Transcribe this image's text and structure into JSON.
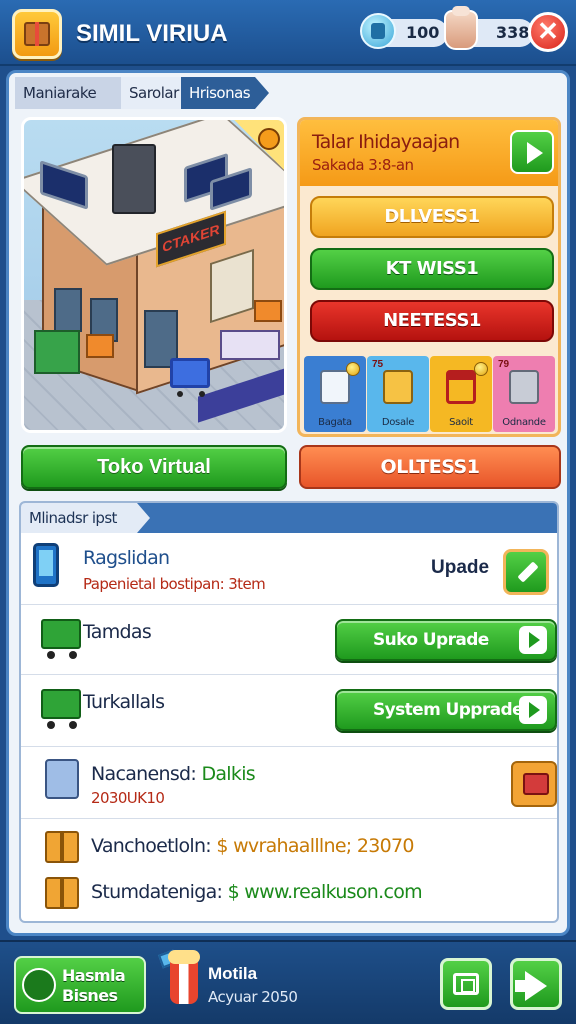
{
  "header": {
    "title": "SIMIL VIRIUA",
    "resource1_value": "100",
    "resource2_value": "338",
    "close_label": "✕"
  },
  "tabs": [
    "Maniarake",
    "Sarolar",
    "Hrisonas"
  ],
  "scene": {
    "sign_text": "CTAKER",
    "main_button_label": "Toko Virtual"
  },
  "quest": {
    "title": "Talar Ihidayaajan",
    "subtitle": "Sakada 3:8-an",
    "options": [
      "DLLVESS1",
      "KT WISS1",
      "NEETESS1"
    ],
    "tiles": [
      {
        "num": "",
        "label": "Bagata"
      },
      {
        "num": "75",
        "label": "Dosale"
      },
      {
        "num": "",
        "label": "Saoit"
      },
      {
        "num": "79",
        "label": "Odnande"
      }
    ],
    "bottom_button_label": "OLLTESS1"
  },
  "info": {
    "tab_label": "Mlinadsr ipst",
    "row1": {
      "title": "Ragslidan",
      "subtitle": "Papenietal bostipan: 3tem",
      "update_label": "Upade"
    },
    "row2": {
      "title": "Tamdas",
      "button_label": "Suko Uprade"
    },
    "row3": {
      "title": "Turkallals",
      "button_label": "System Upprade"
    },
    "row4": {
      "title": "Nacanensd:",
      "title_highlight": "Dalkis",
      "subtitle": "2030UK10"
    },
    "row5": {
      "label": "Vanchoetloln:",
      "value": "$ wvrahaalllne; 23070"
    },
    "row6": {
      "label": "Stumdateniga:",
      "value": "$ www.realkuson.com"
    }
  },
  "bottombar": {
    "business_line1": "Hasmla",
    "business_line2": "Bisnes",
    "mobile_title": "Motila",
    "mobile_sub": "Acyuar 2050"
  },
  "colors": {
    "primary_blue": "#1f4f8c",
    "green": "#1f9a1e",
    "orange": "#f59a17",
    "red": "#d8231a"
  }
}
